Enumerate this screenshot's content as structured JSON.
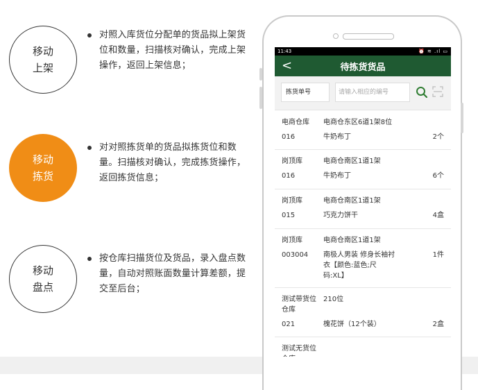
{
  "features": [
    {
      "title_line1": "移动",
      "title_line2": "上架",
      "desc": "对照入库货位分配单的货品拟上架货位和数量，扫描核对确认，完成上架操作，返回上架信息；"
    },
    {
      "title_line1": "移动",
      "title_line2": "拣货",
      "desc": "对对照拣货单的货品拟拣货位和数量。扫描核对确认，完成拣货操作，返回拣货信息；"
    },
    {
      "title_line1": "移动",
      "title_line2": "盘点",
      "desc": "按仓库扫描货位及货品，录入盘点数量，自动对照账面数量计算差额，提交至后台；"
    }
  ],
  "phone": {
    "status": {
      "time": "11:43",
      "icons": "⏰ ≋ .ıl ▭"
    },
    "appbar": {
      "back": "<",
      "title": "待拣货货品"
    },
    "search": {
      "type_label": "拣货单号",
      "placeholder": "请输入相应的编号"
    },
    "items": [
      {
        "warehouse": "电商仓库",
        "location": "电商仓东区6道1架8位",
        "code": "016",
        "name": "牛奶布丁",
        "qty": "2个"
      },
      {
        "warehouse": "岗顶库",
        "location": "电商仓南区1道1架",
        "code": "016",
        "name": "牛奶布丁",
        "qty": "6个"
      },
      {
        "warehouse": "岗顶库",
        "location": "电商仓南区1道1架",
        "code": "015",
        "name": "巧克力饼干",
        "qty": "4盒"
      },
      {
        "warehouse": "岗顶库",
        "location": "电商仓南区1道1架",
        "code": "003004",
        "name": "南极人男装 修身长袖衬衣【颜色:蓝色;尺码:XL】",
        "qty": "1件"
      },
      {
        "warehouse": "测试带货位仓库",
        "location": "210位",
        "code": "021",
        "name": "槐花饼（12个装）",
        "qty": "2盒"
      },
      {
        "warehouse": "测试无货位仓库",
        "location": "",
        "code": "",
        "name": "",
        "qty": ""
      }
    ]
  },
  "colors": {
    "accent": "#f08d16",
    "appbar": "#1f5a32",
    "search_icon": "#2f7d32"
  },
  "icons": [
    "back-arrow-icon",
    "search-icon",
    "scan-icon",
    "alarm-icon",
    "wifi-icon",
    "signal-icon",
    "battery-icon"
  ]
}
